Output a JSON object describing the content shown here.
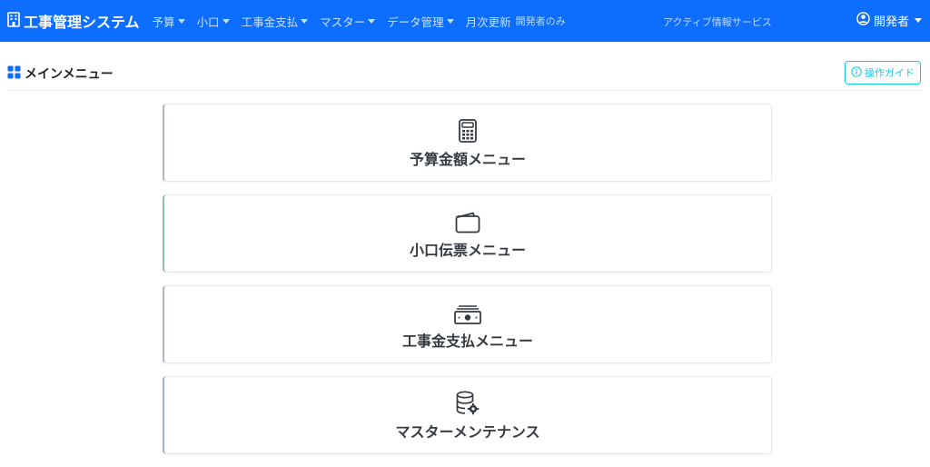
{
  "navbar": {
    "brand": "工事管理システム",
    "brand_icon": "building-icon",
    "items": [
      {
        "label": "予算",
        "dropdown": true
      },
      {
        "label": "小口",
        "dropdown": true
      },
      {
        "label": "工事金支払",
        "dropdown": true
      },
      {
        "label": "マスター",
        "dropdown": true
      },
      {
        "label": "データ管理",
        "dropdown": true
      }
    ],
    "monthly_update": {
      "label": "月次更新",
      "note": "開発者のみ"
    },
    "active_service": "アクティブ情報サービス",
    "user": {
      "label": "開発者",
      "icon": "user-circle-icon"
    },
    "colors": {
      "background": "#0d6efd"
    }
  },
  "header": {
    "title": "メインメニュー",
    "title_icon": "grid-icon",
    "guide_button": "操作ガイド",
    "guide_icon": "info-circle-icon",
    "colors": {
      "accent": "#0dcaf0"
    }
  },
  "menu_cards": [
    {
      "label": "予算金額メニュー",
      "icon": "calculator-icon"
    },
    {
      "label": "小口伝票メニュー",
      "icon": "wallet-icon"
    },
    {
      "label": "工事金支払メニュー",
      "icon": "cash-icon"
    },
    {
      "label": "マスターメンテナンス",
      "icon": "database-gear-icon"
    }
  ]
}
